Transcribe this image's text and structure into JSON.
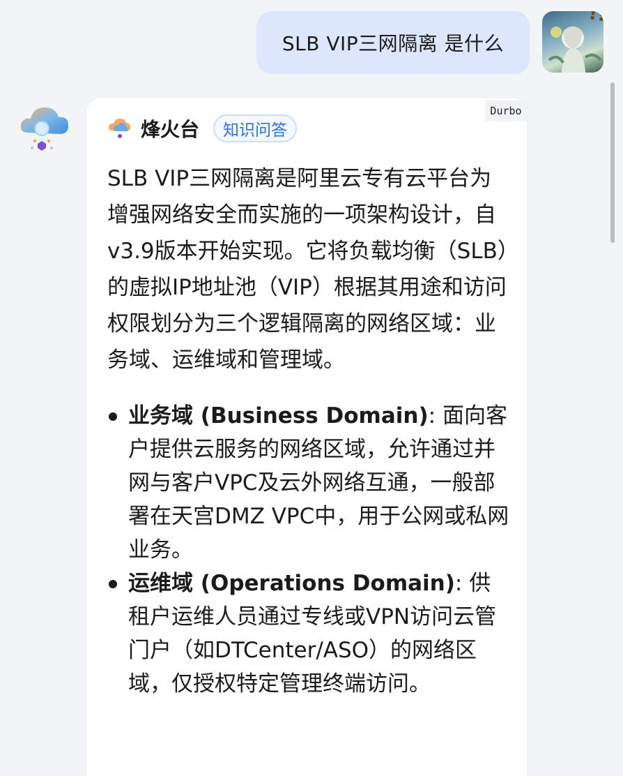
{
  "user_message": {
    "text": "SLB VIP三网隔离 是什么"
  },
  "bot": {
    "name": "烽火台",
    "tag": "知识问答",
    "corner_label": "Durbo"
  },
  "answer": {
    "intro": "SLB VIP三网隔离是阿里云专有云平台为增强网络安全而实施的一项架构设计，自v3.9版本开始实现。它将负载均衡（SLB）的虚拟IP地址池（VIP）根据其用途和访问权限划分为三个逻辑隔离的网络区域：业务域、运维域和管理域。",
    "bullets": [
      {
        "title": "业务域 (Business Domain)",
        "text": ": 面向客户提供云服务的网络区域，允许通过并网与客户VPC及云外网络互通，一般部署在天宫DMZ VPC中，用于公网或私网业务。"
      },
      {
        "title": "运维域 (Operations Domain)",
        "text": ": 供租户运维人员通过专线或VPN访问云管门户（如DTCenter/ASO）的网络区域，仅授权特定管理终端访问。"
      }
    ]
  },
  "colors": {
    "user_bubble": "#dde7fb",
    "tag_text": "#2f6fe6",
    "background": "#f3f4f6"
  },
  "icons": {
    "bot_avatar": "cloud-icon",
    "mini_logo": "cloud-logo-icon",
    "user_avatar": "user-avatar-image"
  }
}
